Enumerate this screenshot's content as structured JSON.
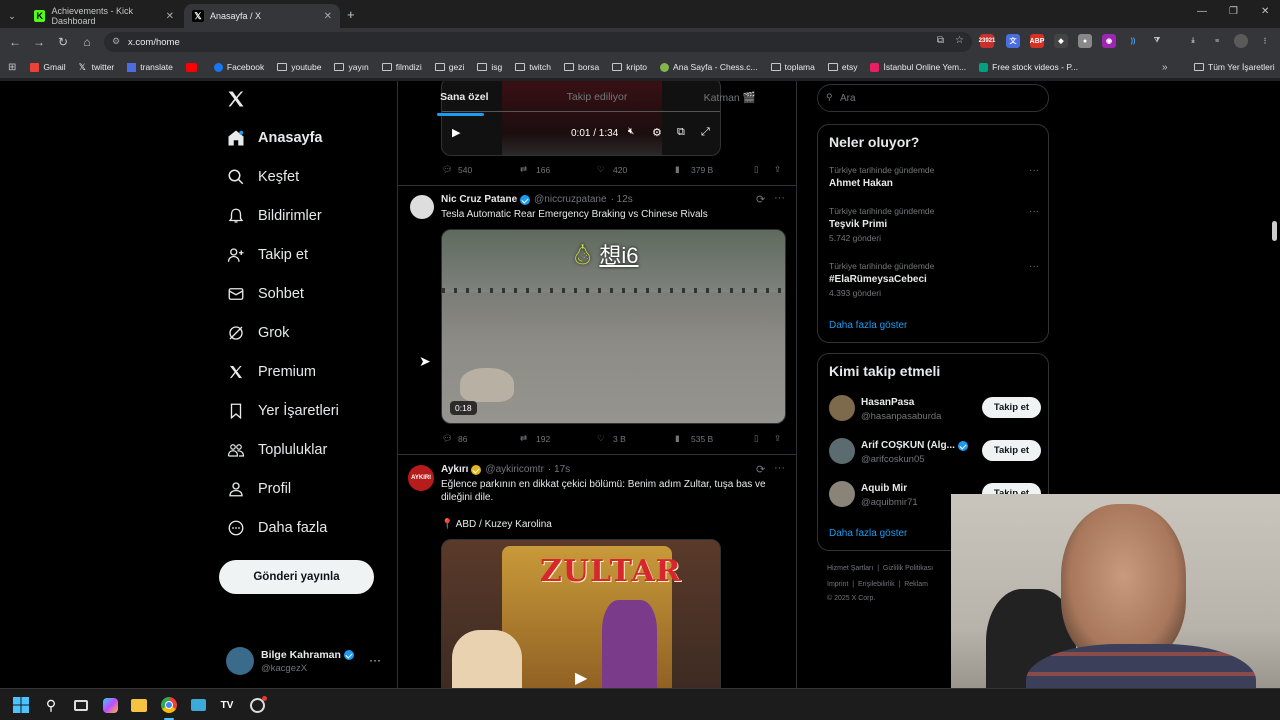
{
  "browser": {
    "tabs": [
      {
        "title": "Achievements - Kick Dashboard",
        "favicon": "kick-icon"
      },
      {
        "title": "Anasayfa / X",
        "favicon": "x-icon"
      }
    ],
    "url": "x.com/home",
    "bookmarks": [
      "Gmail",
      "twitter",
      "translate",
      "",
      "Facebook",
      "youtube",
      "yayın",
      "filmdizi",
      "gezi",
      "isg",
      "twitch",
      "borsa",
      "kripto",
      "Ana Sayfa - Chess.c...",
      "toplama",
      "etsy",
      "İstanbul Online Yem...",
      "Free stock videos - P..."
    ],
    "all_bookmarks": "Tüm Yer İşaretleri",
    "ext_badge": "23921"
  },
  "sidebar": {
    "items": [
      {
        "label": "Anasayfa",
        "icon": "home-icon"
      },
      {
        "label": "Keşfet",
        "icon": "search-icon"
      },
      {
        "label": "Bildirimler",
        "icon": "bell-icon"
      },
      {
        "label": "Takip et",
        "icon": "person-add-icon"
      },
      {
        "label": "Sohbet",
        "icon": "mail-icon"
      },
      {
        "label": "Grok",
        "icon": "grok-icon"
      },
      {
        "label": "Premium",
        "icon": "x-logo-icon"
      },
      {
        "label": "Yer İşaretleri",
        "icon": "bookmark-icon"
      },
      {
        "label": "Topluluklar",
        "icon": "community-icon"
      },
      {
        "label": "Profil",
        "icon": "profile-icon"
      },
      {
        "label": "Daha fazla",
        "icon": "more-circle-icon"
      }
    ],
    "post_button": "Gönderi yayınla",
    "user": {
      "name": "Bilge Kahraman",
      "handle": "@kacgezX"
    }
  },
  "feed": {
    "tabs": [
      "Sana özel",
      "Takip ediliyor",
      "Katman 🎬"
    ],
    "video_time": "0:01 / 1:34",
    "tweet0_stats": {
      "replies": "540",
      "reposts": "166",
      "likes": "420",
      "views": "379 B"
    },
    "tweet1": {
      "name": "Nic Cruz Patane",
      "handle": "@niccruzpatane",
      "time": "· 12s",
      "text": "Tesla Automatic Rear Emergency Braking vs Chinese Rivals",
      "video_caption": "想i6",
      "duration": "0:18",
      "replies": "86",
      "reposts": "192",
      "likes": "3 B",
      "views": "535 B"
    },
    "tweet2": {
      "name": "Aykırı",
      "handle": "@aykiricomtr",
      "time": "· 17s",
      "avatar_text": "AYKIRI",
      "text": "Eğlence parkının en dikkat çekici bölümü: Benim adım Zultar, tuşa bas ve dileğini dile.",
      "location": "📍 ABD / Kuzey Karolina",
      "image_text": "ZULTAR"
    }
  },
  "right": {
    "search_placeholder": "Ara",
    "trends_title": "Neler oluyor?",
    "trends": [
      {
        "context": "Türkiye tarihinde gündemde",
        "topic": "Ahmet Hakan",
        "count": ""
      },
      {
        "context": "Türkiye tarihinde gündemde",
        "topic": "Teşvik Primi",
        "count": "5.742 gönderi"
      },
      {
        "context": "Türkiye tarihinde gündemde",
        "topic": "#ElaRümeysaCebeci",
        "count": "4.393 gönderi"
      }
    ],
    "show_more": "Daha fazla göster",
    "who_title": "Kimi takip etmeli",
    "who": [
      {
        "name": "HasanPasa",
        "handle": "@hasanpasaburda",
        "button": "Takip et"
      },
      {
        "name": "Arif COŞKUN (Alg...",
        "handle": "@arifcoskun05",
        "button": "Takip et"
      },
      {
        "name": "Aquib Mir",
        "handle": "@aquibmir71",
        "button": "Takip et"
      }
    ],
    "who_more": "Daha fazla göster",
    "footer": [
      "Hizmet Şartları",
      "|",
      "Gizlilik Politikası",
      "Imprint",
      "|",
      "Erişilebilirlik",
      "|",
      "Reklam",
      "© 2025 X Corp."
    ]
  }
}
